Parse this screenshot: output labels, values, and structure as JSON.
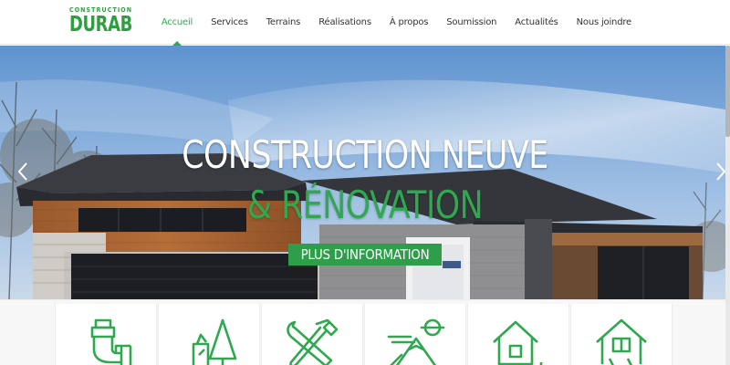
{
  "brand": {
    "logo_top": "CONSTRUCTION",
    "logo_main": "DURAB",
    "accent": "#2fa84f"
  },
  "nav": {
    "items": [
      {
        "label": "Accueil",
        "active": true
      },
      {
        "label": "Services"
      },
      {
        "label": "Terrains"
      },
      {
        "label": "Réalisations"
      },
      {
        "label": "À propos"
      },
      {
        "label": "Soumission"
      },
      {
        "label": "Actualités"
      },
      {
        "label": "Nous joindre"
      }
    ]
  },
  "hero": {
    "title_line1": "CONSTRUCTION NEUVE",
    "title_line2": "& RÉNOVATION",
    "button_label": "PLUS D'INFORMATION",
    "prev_icon": "chevron-left-icon",
    "next_icon": "chevron-right-icon"
  },
  "services": {
    "icons": [
      "plumbing-icon",
      "landscaping-icon",
      "tools-icon",
      "mountain-land-icon",
      "house-icon",
      "house-renovation-icon"
    ]
  }
}
